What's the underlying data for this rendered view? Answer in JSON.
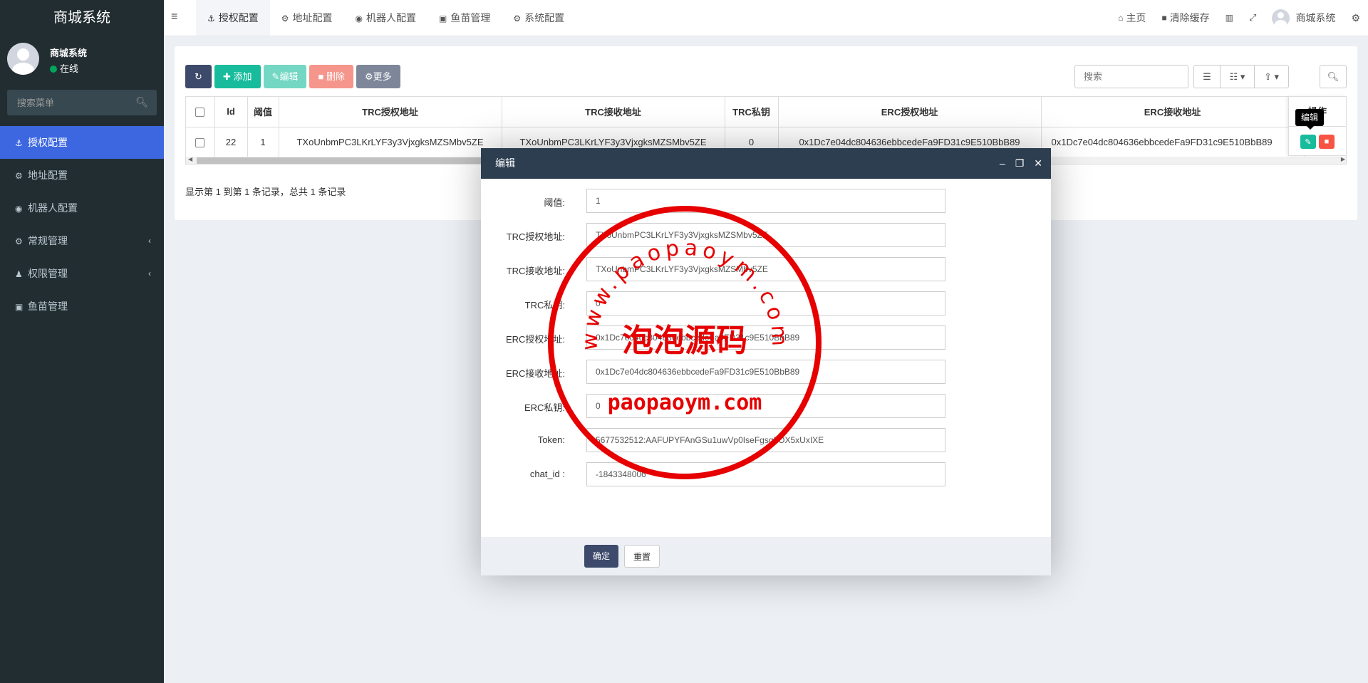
{
  "sidebar": {
    "logo": "商城系统",
    "user_name": "商城系统",
    "user_status": "在线",
    "search_placeholder": "搜索菜单",
    "items": [
      {
        "label": "授权配置",
        "icon": "anchor-icon"
      },
      {
        "label": "地址配置",
        "icon": "gear-icon"
      },
      {
        "label": "机器人配置",
        "icon": "android-icon"
      },
      {
        "label": "常规管理",
        "icon": "gears-icon"
      },
      {
        "label": "权限管理",
        "icon": "users-icon"
      },
      {
        "label": "鱼苗管理",
        "icon": "lock-icon"
      }
    ]
  },
  "header": {
    "tabs": [
      {
        "label": "授权配置"
      },
      {
        "label": "地址配置"
      },
      {
        "label": "机器人配置"
      },
      {
        "label": "鱼苗管理"
      },
      {
        "label": "系统配置"
      }
    ],
    "home": "主页",
    "clear_cache": "清除缓存",
    "user_name": "商城系统"
  },
  "toolbar": {
    "add": "添加",
    "edit": "编辑",
    "delete": "删除",
    "more": "更多",
    "search_placeholder": "搜索"
  },
  "table": {
    "headers": [
      "Id",
      "阈值",
      "TRC授权地址",
      "TRC接收地址",
      "TRC私钥",
      "ERC授权地址",
      "ERC接收地址"
    ],
    "rows": [
      [
        "22",
        "1",
        "TXoUnbmPC3LKrLYF3y3VjxgksMZSMbv5ZE",
        "TXoUnbmPC3LKrLYF3y3VjxgksMZSMbv5ZE",
        "0",
        "0x1Dc7e04dc804636ebbcedeFa9FD31c9E510BbB89",
        "0x1Dc7e04dc804636ebbcedeFa9FD31c9E510BbB89"
      ]
    ],
    "op_header": "操作",
    "tooltip": "编辑",
    "pager_info": "显示第 1 到第 1 条记录，总共 1 条记录"
  },
  "modal": {
    "title": "编辑",
    "fields": [
      {
        "label": "阈值:",
        "value": "1"
      },
      {
        "label": "TRC授权地址:",
        "value": "TXoUnbmPC3LKrLYF3y3VjxgksMZSMbv5ZE"
      },
      {
        "label": "TRC接收地址:",
        "value": "TXoUnbmPC3LKrLYF3y3VjxgksMZSMbv5ZE"
      },
      {
        "label": "TRC私钥:",
        "value": "0"
      },
      {
        "label": "ERC授权地址:",
        "value": "0x1Dc7e04dc804636ebbcedeFa9FD31c9E510BbB89"
      },
      {
        "label": "ERC接收地址:",
        "value": "0x1Dc7e04dc804636ebbcedeFa9FD31c9E510BbB89"
      },
      {
        "label": "ERC私钥:",
        "value": "0"
      },
      {
        "label": "Token:",
        "value": "5677532512:AAFUPYFAnGSu1uwVp0IseFgsg7OX5xUxIXE"
      },
      {
        "label": "chat_id :",
        "value": "-1843348006"
      }
    ],
    "ok": "确定",
    "reset": "重置"
  },
  "watermark": {
    "top_text": "www.paopaoym.com",
    "middle_text": "泡泡源码",
    "bottom_text": "paopaoym.com",
    "color": "#e60000"
  },
  "colors": {
    "sidebar_bg": "#222d32",
    "active_menu": "#3c67e0",
    "modal_header": "#2c3e50",
    "success": "#18bc9c",
    "danger": "#f75444"
  }
}
